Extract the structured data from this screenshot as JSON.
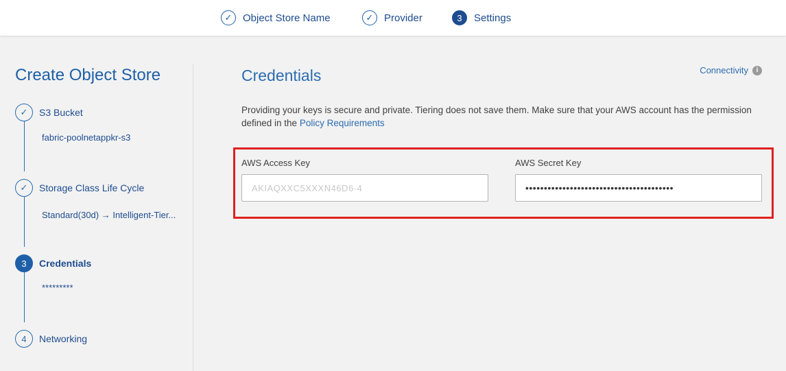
{
  "wizard": {
    "steps": [
      {
        "label": "Object Store Name",
        "status": "done",
        "icon": "check-icon"
      },
      {
        "label": "Provider",
        "status": "done",
        "icon": "check-icon"
      },
      {
        "number": "3",
        "label": "Settings",
        "status": "current"
      }
    ]
  },
  "sidebar": {
    "title": "Create Object Store",
    "steps": [
      {
        "label": "S3 Bucket",
        "value": "fabric-poolnetappkr-s3",
        "status": "done",
        "icon": "check-icon"
      },
      {
        "label": "Storage Class Life Cycle",
        "value": "Standard(30d) → Intelligent-Tier...",
        "status": "done",
        "icon": "check-icon"
      },
      {
        "number": "3",
        "label": "Credentials",
        "value": "*********",
        "status": "current"
      },
      {
        "number": "4",
        "label": "Networking",
        "status": "pending"
      }
    ]
  },
  "main": {
    "title": "Credentials",
    "connectivity_label": "Connectivity",
    "description_text": "Providing your keys is secure and private. Tiering does not save them. Make sure that your AWS account has the permission defined in the ",
    "policy_link": "Policy Requirements",
    "access_key": {
      "label": "AWS Access Key",
      "value": "AKIAQXXC5XXXN46D6·4"
    },
    "secret_key": {
      "label": "AWS Secret Key",
      "value": "••••••••••••••••••••••••••••••••••••••••"
    }
  },
  "colors": {
    "accent": "#1e5fa8",
    "highlight": "#e02020",
    "background": "#f2f2f2"
  }
}
